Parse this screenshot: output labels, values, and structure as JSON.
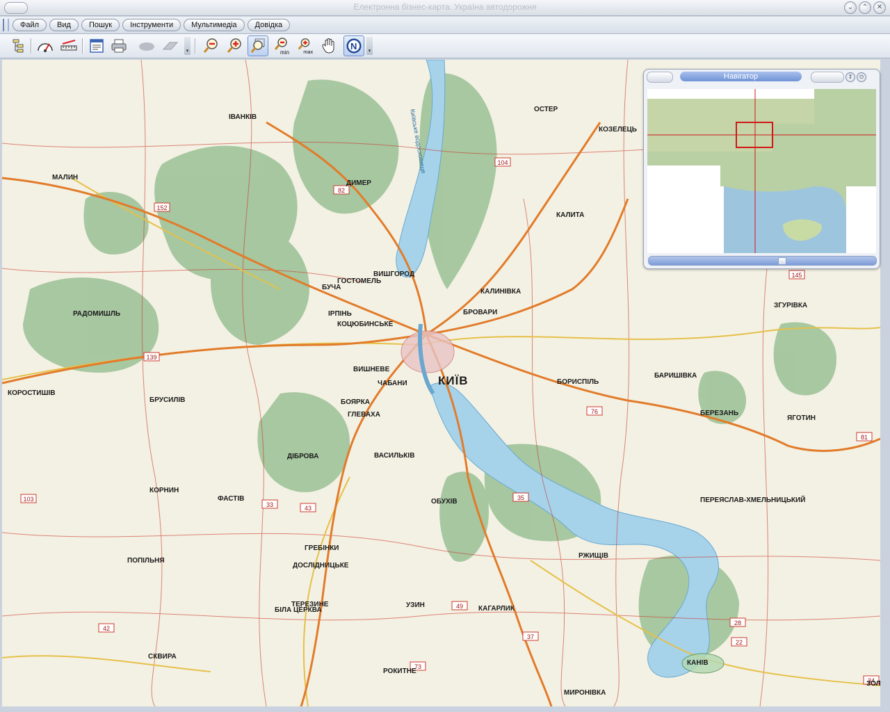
{
  "window": {
    "title": "Електронна бізнес-карта. Україна автодорожня",
    "controls": [
      "⌄",
      "⌃",
      "✕"
    ]
  },
  "menu": {
    "items": [
      "Файл",
      "Вид",
      "Пошук",
      "Інструменти",
      "Мультимедіа",
      "Довідка"
    ]
  },
  "toolbar": {
    "tools": [
      "layers-icon",
      "speedometer-icon",
      "ruler-icon",
      "legend-icon",
      "print-icon",
      "cloud-icon",
      "eraser-icon",
      "zoom-out-icon",
      "zoom-in-icon",
      "zoom-area-icon",
      "zoom-min-icon",
      "zoom-max-icon",
      "pan-hand-icon",
      "north-compass-icon"
    ],
    "zoom_min_label": "min",
    "zoom_max_label": "max",
    "north_label": "N",
    "active_tool": "zoom-area-icon"
  },
  "navigator": {
    "title": "Навігатор",
    "controls": [
      "⇕",
      "⊙"
    ]
  },
  "map": {
    "cities": [
      "КИЇВ",
      "БРОВАРИ",
      "БОРИСПІЛЬ",
      "ВИШГОРОД",
      "ІРПІНЬ",
      "БУЧА",
      "ВИШНЕВЕ",
      "БОЯРКА",
      "ВАСИЛЬКІВ",
      "ОБУХІВ",
      "ФАСТІВ",
      "БІЛА ЦЕРКВА",
      "УЗИН",
      "КАГАРЛИК",
      "РЖИЩІВ",
      "ПЕРЕЯСЛАВ-ХМЕЛЬНИЦЬКИЙ",
      "БЕРЕЗАНЬ",
      "ЯГОТИН",
      "МАЛИН",
      "РАДОМИШЛЬ",
      "КОРОСТИШІВ",
      "ОСТЕР",
      "КОЗЕЛЕЦЬ",
      "КАНІВ",
      "МИРОНІВКА",
      "СКВИРА",
      "ІВАНКІВ",
      "КОЦЮБИНСЬКЕ",
      "ГОСТОМЕЛЬ",
      "ЗГУРІВКА",
      "КАЛИТА",
      "ДИМЕР",
      "БАРИШІВКА",
      "КАЛИНІВКА",
      "ГЛЕВАХА",
      "ДОСЛІДНИЦЬКЕ",
      "РОКИТНЕ",
      "БРУСИЛІВ",
      "ПОПІЛЬНЯ",
      "ТЕРЕЗИНЕ",
      "ГРЕБІНКИ",
      "КОРНИН",
      "ДІБРОВА",
      "ЧАБАНИ",
      "ЗОЛ"
    ],
    "water_label": "Київське водосховище",
    "road_numbers": [
      "152",
      "139",
      "82",
      "104",
      "76",
      "145",
      "81",
      "42",
      "43",
      "35",
      "49",
      "37",
      "34",
      "28",
      "22",
      "103",
      "33",
      "73"
    ]
  },
  "colors": {
    "forest": "#8db98a",
    "water": "#a6d3ea",
    "land": "#f3f1e3",
    "road_main": "#e27b2a",
    "road_regional": "#e6c04a",
    "road_local": "#cc3a2f",
    "menu_active": "#7c9bd8"
  }
}
